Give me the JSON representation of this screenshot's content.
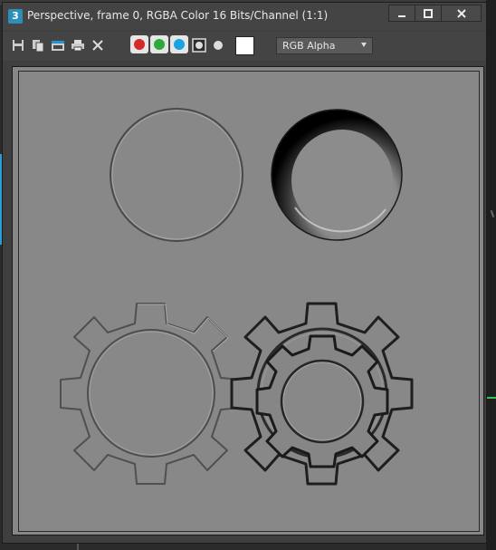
{
  "window": {
    "app_icon_text": "3",
    "title": "Perspective, frame 0, RGBA Color 16 Bits/Channel (1:1)"
  },
  "toolbar": {
    "channel_colors": {
      "red": "#d42a2a",
      "green": "#2faa3a",
      "blue": "#1aa3e0"
    },
    "display_mode": "RGB Alpha"
  },
  "render": {
    "background_color": "#888888"
  }
}
